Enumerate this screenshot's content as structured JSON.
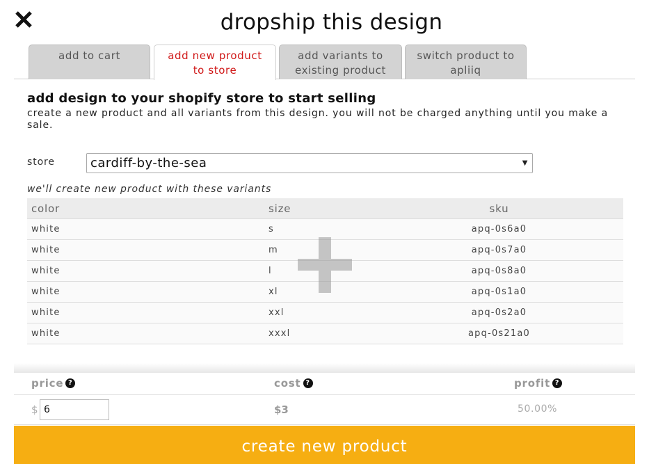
{
  "title": "dropship this design",
  "tabs": [
    {
      "line1": "add to cart",
      "line2": "",
      "active": false
    },
    {
      "line1": "add new product",
      "line2": "to store",
      "active": true
    },
    {
      "line1": "add variants to",
      "line2": "existing product",
      "active": false
    },
    {
      "line1": "switch product to",
      "line2": "apliiq",
      "active": false
    }
  ],
  "section": {
    "heading": "add design to your shopify store to start selling",
    "description": "create a new product and all variants from this design. you will not be charged anything until you make a sale."
  },
  "store": {
    "label": "store",
    "selected": "cardiff-by-the-sea"
  },
  "variants": {
    "caption": "we'll create new product with these variants",
    "headers": [
      "color",
      "size",
      "sku"
    ],
    "rows": [
      [
        "white",
        "s",
        "apq-0s6a0"
      ],
      [
        "white",
        "m",
        "apq-0s7a0"
      ],
      [
        "white",
        "l",
        "apq-0s8a0"
      ],
      [
        "white",
        "xl",
        "apq-0s1a0"
      ],
      [
        "white",
        "xxl",
        "apq-0s2a0"
      ],
      [
        "white",
        "xxxl",
        "apq-0s21a0"
      ]
    ]
  },
  "pricing": {
    "price_label": "price",
    "cost_label": "cost",
    "profit_label": "profit",
    "currency_symbol": "$",
    "price_value": "6",
    "cost_value": "$3",
    "profit_value": "50.00%"
  },
  "create_button": "create new product",
  "colors": {
    "accent": "#f6ae12",
    "active_tab_text": "#d01818",
    "tab_bg": "#d3d3d3"
  }
}
